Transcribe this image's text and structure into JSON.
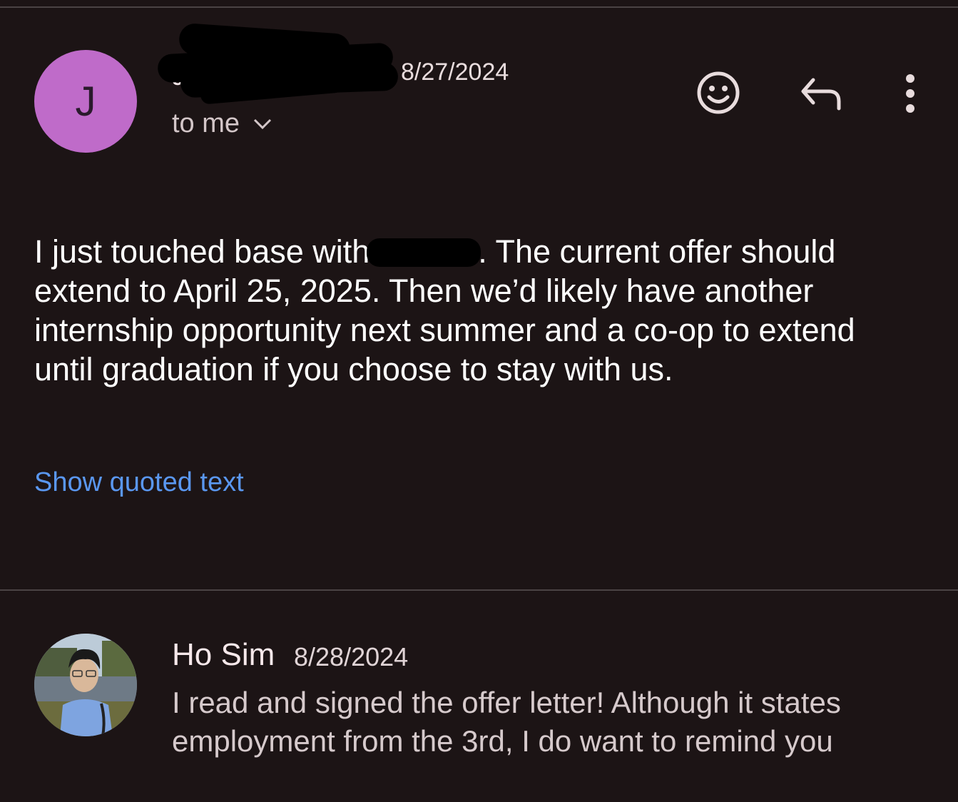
{
  "message_1": {
    "avatar_letter": "J",
    "date": "8/27/2024",
    "recipient_label": "to me",
    "body_before_redaction": "I just touched base with",
    "body_after_redaction": ". The current offer should extend to April 25, 2025. Then we’d likely have another internship opportunity next summer and a co-op to extend until graduation if you choose to stay with us.",
    "show_quoted_label": "Show quoted text",
    "actions": [
      {
        "icon": "emoji-reaction-icon"
      },
      {
        "icon": "reply-icon"
      },
      {
        "icon": "more-options-icon"
      }
    ]
  },
  "message_2": {
    "sender": "Ho Sim",
    "date": "8/28/2024",
    "preview": "I read and signed the offer letter! Although it states employment from the 3rd, I do want to remind you"
  },
  "colors": {
    "background": "#1c1415",
    "avatar_j": "#bf6bc9",
    "link": "#5a97f0"
  }
}
